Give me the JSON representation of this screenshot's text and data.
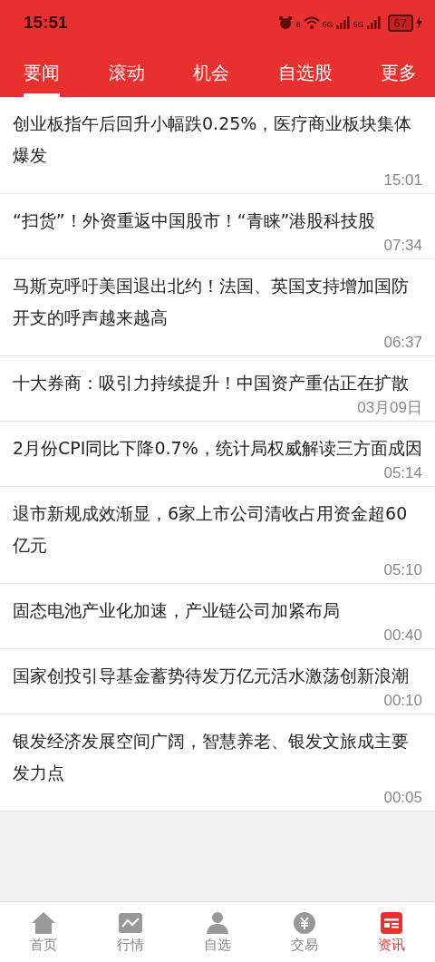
{
  "status_bar": {
    "time": "15:51",
    "wifi_label": "6",
    "sim_labels": [
      "5G",
      "5G"
    ],
    "battery": "67"
  },
  "tabs": [
    {
      "label": "要闻",
      "selected": true
    },
    {
      "label": "滚动",
      "selected": false
    },
    {
      "label": "机会",
      "selected": false
    },
    {
      "label": "自选股",
      "selected": false
    },
    {
      "label": "更多",
      "selected": false
    }
  ],
  "news": [
    {
      "title": "创业板指午后回升小幅跌0.25%，医疗商业板块集体爆发",
      "time": "15:01"
    },
    {
      "title": "“扫货”！外资重返中国股市！“青睐”港股科技股",
      "time": "07:34"
    },
    {
      "title": "马斯克呼吁美国退出北约！法国、英国支持增加国防开支的呼声越来越高",
      "time": "06:37"
    },
    {
      "title": "十大券商：吸引力持续提升！中国资产重估正在扩散",
      "time": "03月09日"
    },
    {
      "title": "2月份CPI同比下降0.7%，统计局权威解读三方面成因",
      "time": "05:14"
    },
    {
      "title": "退市新规成效渐显，6家上市公司清收占用资金超60亿元",
      "time": "05:10"
    },
    {
      "title": "固态电池产业化加速，产业链公司加紧布局",
      "time": "00:40"
    },
    {
      "title": "国家创投引导基金蓄势待发万亿元活水激荡创新浪潮",
      "time": "00:10"
    },
    {
      "title": "银发经济发展空间广阔，智慧养老、银发文旅成主要发力点",
      "time": "00:05"
    }
  ],
  "bottom_nav": [
    {
      "kind": "home",
      "label": "首页",
      "selected": false
    },
    {
      "kind": "chart",
      "label": "行情",
      "selected": false
    },
    {
      "kind": "person",
      "label": "自选",
      "selected": false
    },
    {
      "kind": "trade",
      "label": "交易",
      "selected": false
    },
    {
      "kind": "news",
      "label": "资讯",
      "selected": true
    }
  ]
}
